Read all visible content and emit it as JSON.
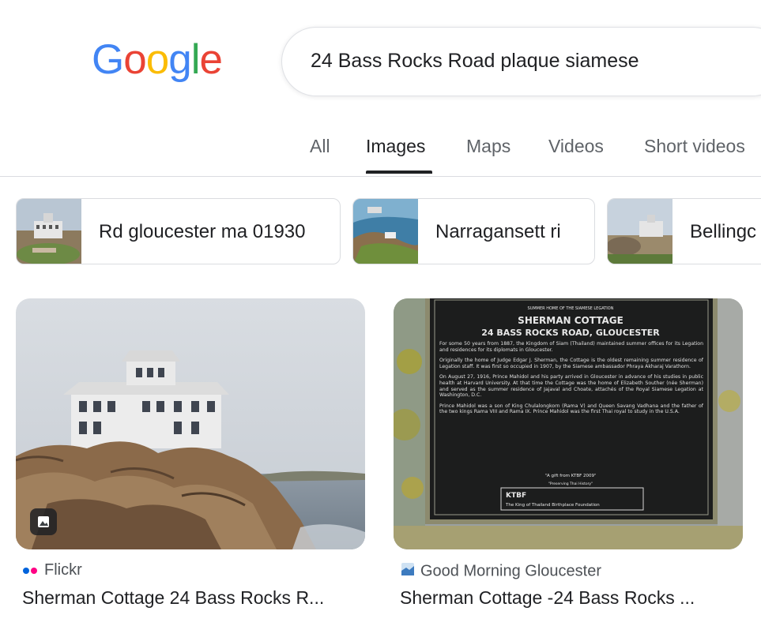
{
  "logo": {
    "letters": [
      "G",
      "o",
      "o",
      "g",
      "l",
      "e"
    ],
    "colors": [
      "#4285F4",
      "#EA4335",
      "#FBBC05",
      "#4285F4",
      "#34A853",
      "#EA4335"
    ]
  },
  "search": {
    "query": "24 Bass Rocks Road plaque siamese"
  },
  "tabs": [
    {
      "label": "All"
    },
    {
      "label": "Images",
      "active": true
    },
    {
      "label": "Maps"
    },
    {
      "label": "Videos"
    },
    {
      "label": "Short videos"
    }
  ],
  "chips": [
    {
      "label": "Rd gloucester ma 01930"
    },
    {
      "label": "Narragansett ri"
    },
    {
      "label": "Bellingc"
    }
  ],
  "results": [
    {
      "source": "Flickr",
      "title": "Sherman Cottage 24 Bass Rocks R..."
    },
    {
      "source": "Good Morning Gloucester",
      "title": "Sherman Cottage -24 Bass Rocks ...",
      "plaque": {
        "heading_small": "SUMMER HOME OF THE SIAMESE LEGATION",
        "heading_1": "SHERMAN COTTAGE",
        "heading_2": "24 BASS ROCKS ROAD, GLOUCESTER",
        "p1": "For some 50 years from 1887, the Kingdom of Siam (Thailand) maintained summer offices for its Legation and residences for its diplomats in Gloucester.",
        "p2": "Originally the home of Judge Edgar J. Sherman, the Cottage is the oldest remaining summer residence of Legation staff. It was first so occupied in 1907, by the Siamese ambassador Phraya Akharaj Varathorn.",
        "p3": "On August 27, 1916, Prince Mahidol and his party arrived in Gloucester in advance of his studies in public health at Harvard University. At that time the Cottage was the home of Elizabeth Souther (née Sherman) and served as the summer residence of Jajaval and Choate, attachés of the Royal Siamese Legation at Washington, D.C.",
        "p4": "Prince Mahidol was a son of King Chulalongkorn (Rama V) and Queen Savang Vadhana and the father of the two kings Rama VIII and Rama IX. Prince Mahidol was the first Thai royal to study in the U.S.A.",
        "gift": "\"A gift from KTBF 2009\"",
        "motto": "\"Preserving Thai History\"",
        "ktbf": "KTBF",
        "foundation": "The King of Thailand Birthplace Foundation"
      }
    }
  ]
}
